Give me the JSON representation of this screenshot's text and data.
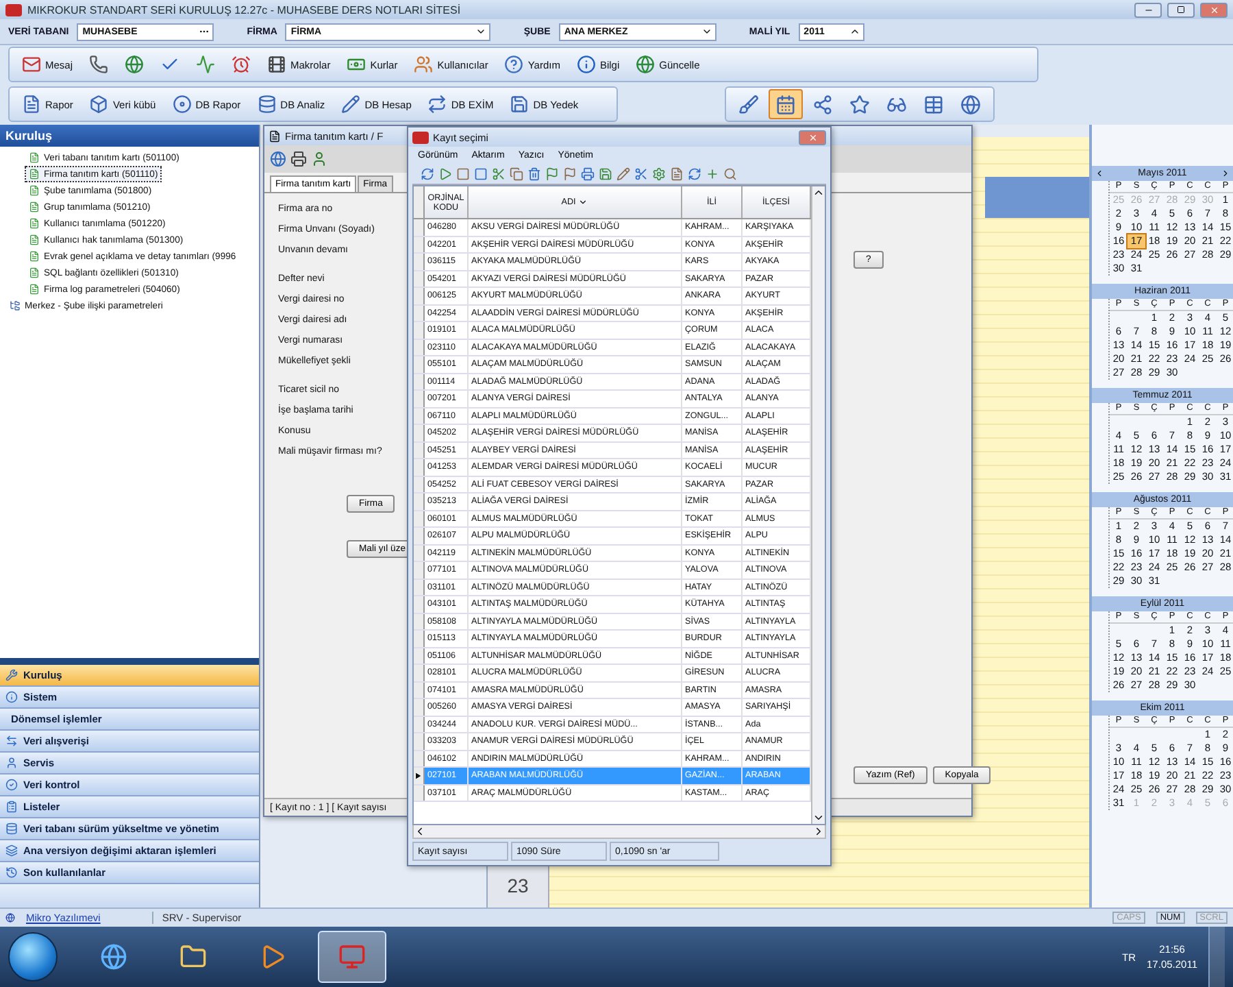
{
  "window": {
    "title": "MIKROKUR STANDART SERİ KURULUŞ 12.27c - MUHASEBE DERS NOTLARI SİTESİ"
  },
  "header_fields": [
    {
      "label": "VERİ TABANI",
      "value": "MUHASEBE",
      "kind": "browse"
    },
    {
      "label": "FİRMA",
      "value": "FİRMA",
      "kind": "dropdown"
    },
    {
      "label": "ŞUBE",
      "value": "ANA MERKEZ",
      "kind": "dropdown"
    },
    {
      "label": "MALİ YIL",
      "value": "2011",
      "kind": "spinner"
    }
  ],
  "toolbar_main": [
    {
      "kind": "labeled",
      "label": "Mesaj"
    },
    {
      "kind": "icon"
    },
    {
      "kind": "icon"
    },
    {
      "kind": "icon"
    },
    {
      "kind": "icon"
    },
    {
      "kind": "icon"
    },
    {
      "kind": "labeled",
      "label": "Makrolar"
    },
    {
      "kind": "labeled",
      "label": "Kurlar"
    },
    {
      "kind": "labeled",
      "label": "Kullanıcılar"
    },
    {
      "kind": "labeled",
      "label": "Yardım"
    },
    {
      "kind": "labeled",
      "label": "Bilgi"
    },
    {
      "kind": "labeled",
      "label": "Güncelle"
    }
  ],
  "toolbar_db": [
    "Rapor",
    "Veri kübü",
    "DB Rapor",
    "DB Analiz",
    "DB Hesap",
    "DB EXİM",
    "DB Yedek"
  ],
  "toolbar_tools": [
    {
      "selected": false
    },
    {
      "selected": true
    },
    {
      "selected": false
    },
    {
      "selected": false
    },
    {
      "selected": false
    },
    {
      "selected": false
    },
    {
      "selected": false
    }
  ],
  "sidebar": {
    "title": "Kuruluş",
    "tree": [
      {
        "label": "Veri tabanı tanıtım kartı (501100)",
        "selected": false,
        "kind": "leaf"
      },
      {
        "label": "Firma tanıtım kartı (501110)",
        "selected": true,
        "kind": "leaf"
      },
      {
        "label": "Şube tanımlama (501800)",
        "selected": false,
        "kind": "leaf"
      },
      {
        "label": "Grup tanımlama (501210)",
        "selected": false,
        "kind": "leaf"
      },
      {
        "label": "Kullanıcı tanımlama (501220)",
        "selected": false,
        "kind": "leaf"
      },
      {
        "label": "Kullanıcı hak tanımlama (501300)",
        "selected": false,
        "kind": "leaf"
      },
      {
        "label": "Evrak genel açıklama ve detay tanımları (9996",
        "selected": false,
        "kind": "leaf"
      },
      {
        "label": "SQL bağlantı özellikleri (501310)",
        "selected": false,
        "kind": "leaf"
      },
      {
        "label": "Firma log parametreleri (504060)",
        "selected": false,
        "kind": "leaf"
      },
      {
        "label": "Merkez - Şube ilişki parametreleri",
        "selected": false,
        "kind": "group"
      }
    ]
  },
  "nav": [
    {
      "label": "Kuruluş",
      "selected": true
    },
    {
      "label": "Sistem",
      "selected": false
    },
    {
      "label": "Dönemsel işlemler",
      "selected": false
    },
    {
      "label": "Veri alışverişi",
      "selected": false
    },
    {
      "label": "Servis",
      "selected": false
    },
    {
      "label": "Veri kontrol",
      "selected": false
    },
    {
      "label": "Listeler",
      "selected": false
    },
    {
      "label": "Veri tabanı sürüm yükseltme ve yönetim",
      "selected": false
    },
    {
      "label": "Ana versiyon değişimi aktaran işlemleri",
      "selected": false
    },
    {
      "label": "Son kullanılanlar",
      "selected": false
    }
  ],
  "firma_window": {
    "title": "Firma tanıtım kartı / F",
    "tabs": [
      {
        "label": "Firma tanıtım kartı",
        "selected": true
      },
      {
        "label": "Firma",
        "selected": false
      }
    ],
    "field_groups": [
      [
        "Firma ara no",
        "Firma Unvanı (Soyadı)",
        "Unvanın devamı"
      ],
      [
        "Defter nevi",
        "Vergi dairesi no",
        "Vergi dairesi adı",
        "Vergi numarası",
        "Mükellefiyet şekli"
      ],
      [
        "Ticaret sicil no",
        "İşe başlama tarihi",
        "Konusu",
        "Mali müşavir firması mı?"
      ]
    ],
    "help_button": "?",
    "buttons": [
      "Firma",
      "Mali yıl üze"
    ],
    "side_buttons": [
      "Yazım (Ref)",
      "Kopyala"
    ],
    "status": "[ Kayıt no : 1 ] [ Kayıt sayısı"
  },
  "day_view": {
    "hour": "23"
  },
  "record_window": {
    "title": "Kayıt seçimi",
    "menu": [
      "Görünüm",
      "Aktarım",
      "Yazıcı",
      "Yönetim"
    ],
    "columns": [
      "ORJİNAL KODU",
      "ADI",
      "İLİ",
      "İLÇESİ"
    ],
    "rows": [
      {
        "cells": [
          "046280",
          "AKSU VERGİ DAİRESİ MÜDÜRLÜĞÜ",
          "KAHRAM...",
          "KARŞIYAKA"
        ],
        "selected": false
      },
      {
        "cells": [
          "042201",
          "AKŞEHİR VERGİ DAİRESİ MÜDÜRLÜĞÜ",
          "KONYA",
          "AKŞEHİR"
        ],
        "selected": false
      },
      {
        "cells": [
          "036115",
          "AKYAKA MALMÜDÜRLÜĞÜ",
          "KARS",
          "AKYAKA"
        ],
        "selected": false
      },
      {
        "cells": [
          "054201",
          "AKYAZI VERGİ DAİRESİ MÜDÜRLÜĞÜ",
          "SAKARYA",
          "PAZAR"
        ],
        "selected": false
      },
      {
        "cells": [
          "006125",
          "AKYURT MALMÜDÜRLÜĞÜ",
          "ANKARA",
          "AKYURT"
        ],
        "selected": false
      },
      {
        "cells": [
          "042254",
          "ALAADDİN VERGİ DAİRESİ MÜDÜRLÜĞÜ",
          "KONYA",
          "AKŞEHİR"
        ],
        "selected": false
      },
      {
        "cells": [
          "019101",
          "ALACA MALMÜDÜRLÜĞÜ",
          "ÇORUM",
          "ALACA"
        ],
        "selected": false
      },
      {
        "cells": [
          "023110",
          "ALACAKAYA MALMÜDÜRLÜĞÜ",
          "ELAZIĞ",
          "ALACAKAYA"
        ],
        "selected": false
      },
      {
        "cells": [
          "055101",
          "ALAÇAM MALMÜDÜRLÜĞÜ",
          "SAMSUN",
          "ALAÇAM"
        ],
        "selected": false
      },
      {
        "cells": [
          "001114",
          "ALADAĞ MALMÜDÜRLÜĞÜ",
          "ADANA",
          "ALADAĞ"
        ],
        "selected": false
      },
      {
        "cells": [
          "007201",
          "ALANYA VERGİ DAİRESİ",
          "ANTALYA",
          "ALANYA"
        ],
        "selected": false
      },
      {
        "cells": [
          "067110",
          "ALAPLI MALMÜDÜRLÜĞÜ",
          "ZONGUL...",
          "ALAPLI"
        ],
        "selected": false
      },
      {
        "cells": [
          "045202",
          "ALAŞEHİR VERGİ DAİRESİ MÜDÜRLÜĞÜ",
          "MANİSA",
          "ALAŞEHİR"
        ],
        "selected": false
      },
      {
        "cells": [
          "045251",
          "ALAYBEY VERGİ DAİRESİ",
          "MANİSA",
          "ALAŞEHİR"
        ],
        "selected": false
      },
      {
        "cells": [
          "041253",
          "ALEMDAR VERGİ DAİRESİ MÜDÜRLÜĞÜ",
          "KOCAELİ",
          "MUCUR"
        ],
        "selected": false
      },
      {
        "cells": [
          "054252",
          "ALİ FUAT CEBESOY VERGİ DAİRESİ",
          "SAKARYA",
          "PAZAR"
        ],
        "selected": false
      },
      {
        "cells": [
          "035213",
          "ALİAĞA VERGİ DAİRESİ",
          "İZMİR",
          "ALİAĞA"
        ],
        "selected": false
      },
      {
        "cells": [
          "060101",
          "ALMUS MALMÜDÜRLÜĞÜ",
          "TOKAT",
          "ALMUS"
        ],
        "selected": false
      },
      {
        "cells": [
          "026107",
          "ALPU MALMÜDÜRLÜĞÜ",
          "ESKİŞEHİR",
          "ALPU"
        ],
        "selected": false
      },
      {
        "cells": [
          "042119",
          "ALTINEKİN MALMÜDÜRLÜĞÜ",
          "KONYA",
          "ALTINEKİN"
        ],
        "selected": false
      },
      {
        "cells": [
          "077101",
          "ALTINOVA MALMÜDÜRLÜĞÜ",
          "YALOVA",
          "ALTINOVA"
        ],
        "selected": false
      },
      {
        "cells": [
          "031101",
          "ALTINÖZÜ MALMÜDÜRLÜĞÜ",
          "HATAY",
          "ALTINÖZÜ"
        ],
        "selected": false
      },
      {
        "cells": [
          "043101",
          "ALTINTAŞ MALMÜDÜRLÜĞÜ",
          "KÜTAHYA",
          "ALTINTAŞ"
        ],
        "selected": false
      },
      {
        "cells": [
          "058108",
          "ALTINYAYLA MALMÜDÜRLÜĞÜ",
          "SİVAS",
          "ALTINYAYLA"
        ],
        "selected": false
      },
      {
        "cells": [
          "015113",
          "ALTINYAYLA MALMÜDÜRLÜĞÜ",
          "BURDUR",
          "ALTINYAYLA"
        ],
        "selected": false
      },
      {
        "cells": [
          "051106",
          "ALTUNHİSAR MALMÜDÜRLÜĞÜ",
          "NİĞDE",
          "ALTUNHİSAR"
        ],
        "selected": false
      },
      {
        "cells": [
          "028101",
          "ALUCRA MALMÜDÜRLÜĞÜ",
          "GİRESUN",
          "ALUCRA"
        ],
        "selected": false
      },
      {
        "cells": [
          "074101",
          "AMASRA MALMÜDÜRLÜĞÜ",
          "BARTIN",
          "AMASRA"
        ],
        "selected": false
      },
      {
        "cells": [
          "005260",
          "AMASYA VERGİ DAİRESİ",
          "AMASYA",
          "SARIYAHŞİ"
        ],
        "selected": false
      },
      {
        "cells": [
          "034244",
          "ANADOLU KUR. VERGİ DAİRESİ MÜDÜ...",
          "İSTANB...",
          "Ada"
        ],
        "selected": false
      },
      {
        "cells": [
          "033203",
          "ANAMUR VERGİ DAİRESİ MÜDÜRLÜĞÜ",
          "İÇEL",
          "ANAMUR"
        ],
        "selected": false
      },
      {
        "cells": [
          "046102",
          "ANDIRIN MALMÜDÜRLÜĞÜ",
          "KAHRAM...",
          "ANDIRIN"
        ],
        "selected": false
      },
      {
        "cells": [
          "027101",
          "ARABAN MALMÜDÜRLÜĞÜ",
          "GAZİAN...",
          "ARABAN"
        ],
        "selected": true
      },
      {
        "cells": [
          "037101",
          "ARAÇ MALMÜDÜRLÜĞÜ",
          "KASTAM...",
          "ARAÇ"
        ],
        "selected": false
      }
    ],
    "status": [
      "Kayıt sayısı",
      "1090 Süre",
      "0,1090 sn 'ar"
    ]
  },
  "calendar": [
    {
      "title": "Mayıs 2011",
      "arrows": true,
      "weekdays": [
        "P",
        "S",
        "Ç",
        "P",
        "C",
        "C",
        "P"
      ],
      "weeks": [
        [
          {
            "day": "25",
            "other_month": true
          },
          {
            "day": "26",
            "other_month": true
          },
          {
            "day": "27",
            "other_month": true
          },
          {
            "day": "28",
            "other_month": true
          },
          {
            "day": "29",
            "other_month": true
          },
          {
            "day": "30",
            "other_month": true
          },
          "1"
        ],
        [
          "2",
          "3",
          "4",
          "5",
          "6",
          "7",
          "8"
        ],
        [
          "9",
          "10",
          "11",
          "12",
          "13",
          "14",
          "15"
        ],
        [
          "16",
          {
            "day": "17",
            "selected": true
          },
          "18",
          "19",
          "20",
          "21",
          "22"
        ],
        [
          "23",
          "24",
          "25",
          "26",
          "27",
          "28",
          "29"
        ],
        [
          "30",
          "31"
        ]
      ]
    },
    {
      "title": "Haziran 2011",
      "weekdays": [
        "P",
        "S",
        "Ç",
        "P",
        "C",
        "C",
        "P"
      ],
      "weeks": [
        [
          "1",
          "2",
          "3",
          "4",
          "5"
        ],
        [
          "6",
          "7",
          "8",
          "9",
          "10",
          "11",
          "12"
        ],
        [
          "13",
          "14",
          "15",
          "16",
          "17",
          "18",
          "19"
        ],
        [
          "20",
          "21",
          "22",
          "23",
          "24",
          "25",
          "26"
        ],
        [
          "27",
          "28",
          "29",
          "30"
        ]
      ]
    },
    {
      "title": "Temmuz 2011",
      "weekdays": [
        "P",
        "S",
        "Ç",
        "P",
        "C",
        "C",
        "P"
      ],
      "weeks": [
        [
          "1",
          "2",
          "3"
        ],
        [
          "4",
          "5",
          "6",
          "7",
          "8",
          "9",
          "10"
        ],
        [
          "11",
          "12",
          "13",
          "14",
          "15",
          "16",
          "17"
        ],
        [
          "18",
          "19",
          "20",
          "21",
          "22",
          "23",
          "24"
        ],
        [
          "25",
          "26",
          "27",
          "28",
          "29",
          "30",
          "31"
        ]
      ]
    },
    {
      "title": "Ağustos 2011",
      "weekdays": [
        "P",
        "S",
        "Ç",
        "P",
        "C",
        "C",
        "P"
      ],
      "weeks": [
        [
          "1",
          "2",
          "3",
          "4",
          "5",
          "6",
          "7"
        ],
        [
          "8",
          "9",
          "10",
          "11",
          "12",
          "13",
          "14"
        ],
        [
          "15",
          "16",
          "17",
          "18",
          "19",
          "20",
          "21"
        ],
        [
          "22",
          "23",
          "24",
          "25",
          "26",
          "27",
          "28"
        ],
        [
          "29",
          "30",
          "31"
        ]
      ]
    },
    {
      "title": "Eylül 2011",
      "weekdays": [
        "P",
        "S",
        "Ç",
        "P",
        "C",
        "C",
        "P"
      ],
      "weeks": [
        [
          "1",
          "2",
          "3",
          "4"
        ],
        [
          "5",
          "6",
          "7",
          "8",
          "9",
          "10",
          "11"
        ],
        [
          "12",
          "13",
          "14",
          "15",
          "16",
          "17",
          "18"
        ],
        [
          "19",
          "20",
          "21",
          "22",
          "23",
          "24",
          "25"
        ],
        [
          "26",
          "27",
          "28",
          "29",
          "30"
        ]
      ]
    },
    {
      "title": "Ekim 2011",
      "weekdays": [
        "P",
        "S",
        "Ç",
        "P",
        "C",
        "C",
        "P"
      ],
      "weeks": [
        [
          "1",
          "2"
        ],
        [
          "3",
          "4",
          "5",
          "6",
          "7",
          "8",
          "9"
        ],
        [
          "10",
          "11",
          "12",
          "13",
          "14",
          "15",
          "16"
        ],
        [
          "17",
          "18",
          "19",
          "20",
          "21",
          "22",
          "23"
        ],
        [
          "24",
          "25",
          "26",
          "27",
          "28",
          "29",
          "30"
        ],
        [
          "31",
          {
            "day": "1",
            "other_month": true
          },
          {
            "day": "2",
            "other_month": true
          },
          {
            "day": "3",
            "other_month": true
          },
          {
            "day": "4",
            "other_month": true
          },
          {
            "day": "5",
            "other_month": true
          },
          {
            "day": "6",
            "other_month": true
          }
        ]
      ]
    }
  ],
  "status_bar": {
    "link": "Mikro Yazılımevi",
    "user": "SRV - Supervisor",
    "keys": [
      {
        "label": "CAPS",
        "on": false
      },
      {
        "label": "NUM",
        "on": true
      },
      {
        "label": "SCRL",
        "on": false
      }
    ]
  },
  "taskbar": {
    "apps": [
      {
        "selected": false
      },
      {
        "selected": false
      },
      {
        "selected": false
      },
      {
        "selected": true
      }
    ],
    "language": "TR",
    "time": "21:56",
    "date": "17.05.2011"
  }
}
